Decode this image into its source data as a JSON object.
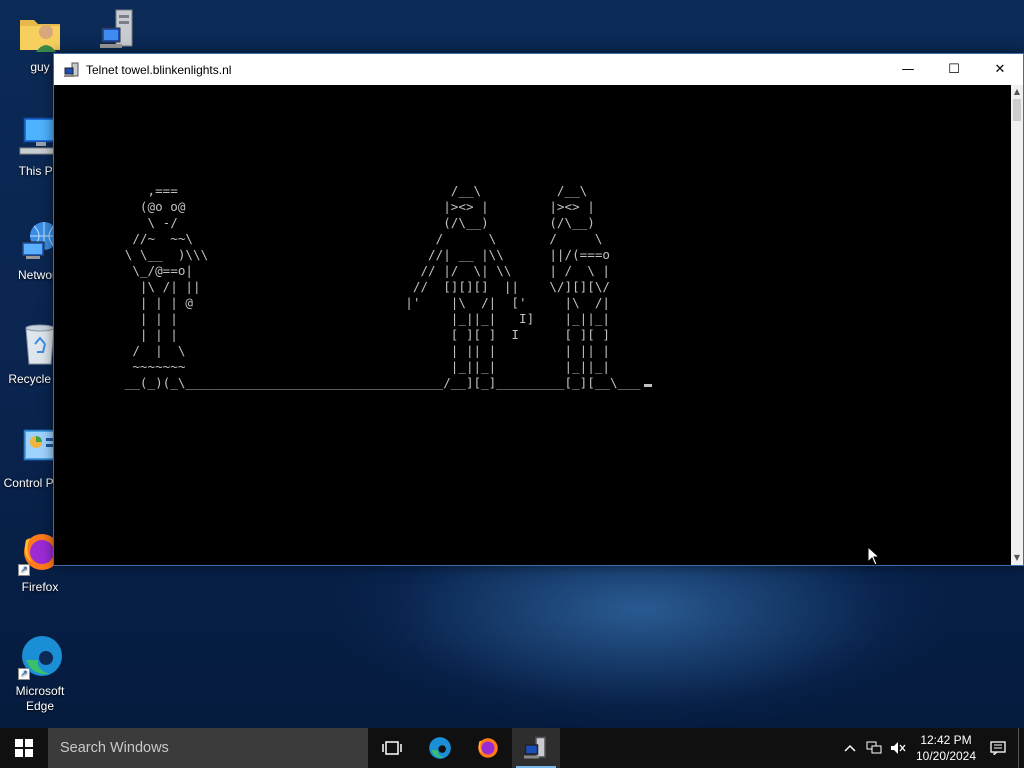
{
  "desktop": {
    "icons": [
      {
        "label": "guy",
        "icon": "user-folder-icon"
      },
      {
        "label": "",
        "icon": "network-computer-icon"
      },
      {
        "label": "This PC",
        "icon": "this-pc-icon"
      },
      {
        "label": "Network",
        "icon": "network-icon"
      },
      {
        "label": "Recycle Bin",
        "icon": "recycle-bin-icon"
      },
      {
        "label": "Control Panel",
        "icon": "control-panel-icon"
      },
      {
        "label": "Firefox",
        "icon": "firefox-icon"
      },
      {
        "label": "Microsoft Edge",
        "icon": "edge-icon"
      }
    ]
  },
  "window": {
    "title": "Telnet towel.blinkenlights.nl",
    "buttons": {
      "minimize": "—",
      "maximize": "☐",
      "close": "✕"
    },
    "console_text": "      ,===                                    /__\\          /__\\\n     (@o o@                                  |><> |        |><> |\n      \\ -/                                   (/\\__)        (/\\__)\n    //~  ~~\\                                /      \\       /     \\\n   \\ \\__  )\\\\\\                             //| __ |\\\\      ||/(===o\n    \\_/@==o|                              // |/  \\| \\\\     | /  \\ |\n     |\\ /| ||                            //  [][][]  ||    \\/][][\\/\n     | | | @                            |'    |\\  /|  ['     |\\  /|\n     | | |                                    |_||_|   I]    |_||_|\n     | | |                                    [ ][ ]  I      [ ][ ]\n    /  |  \\                                   | || |         | || |\n    ~~~~~~~                                   |_||_|         |_||_|\n   __(_)(_\\__________________________________/__][_]_________[_][__\\___"
  },
  "taskbar": {
    "search_placeholder": "Search Windows",
    "items": [
      "task-view-icon",
      "edge-icon",
      "firefox-icon",
      "telnet-icon"
    ],
    "clock": {
      "time": "12:42 PM",
      "date": "10/20/2024"
    }
  },
  "colors": {
    "console_bg": "#000000",
    "console_fg": "#c0c0c0",
    "taskbar_bg": "#101010",
    "accent": "#76b9ed"
  }
}
